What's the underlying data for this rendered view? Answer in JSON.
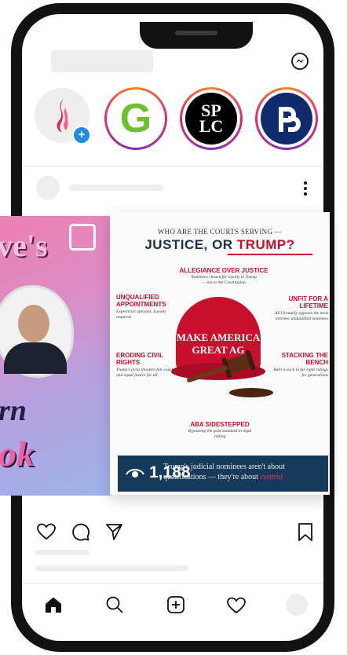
{
  "app": {
    "name": "Instagram"
  },
  "header": {
    "messenger_icon": "messenger-icon"
  },
  "stories": [
    {
      "name": "your-story",
      "icon": "flame-logo"
    },
    {
      "name": "g-logo",
      "text": "G"
    },
    {
      "name": "splc-logo",
      "text": "SP LC"
    },
    {
      "name": "pp-logo",
      "text": "P"
    }
  ],
  "post_left": {
    "text_top": "ve's",
    "text_mid": "rn",
    "text_bot": "ok"
  },
  "post_right": {
    "eyebrow": "WHO ARE THE COURTS SERVING —",
    "title_a": "JUSTICE, OR ",
    "title_b": "TRUMP?",
    "allegiance_title": "ALLEGIANCE OVER JUSTICE",
    "allegiance_sub": "Nominees chosen for loyalty to Trump — not to the Constitution",
    "unqualified_title": "UNQUALIFIED APPOINTMENTS",
    "unqualified_sub": "Experience optional. Loyalty required.",
    "unfit_title": "UNFIT FOR A LIFETIME",
    "unfit_sub": "AEJ formally opposes the most extreme, unqualified nominees",
    "eroding_title": "ERODING CIVIL RIGHTS",
    "eroding_sub": "Trump's picks threaten fair courts and equal justice for all.",
    "stacking_title": "STACKING THE BENCH",
    "stacking_sub": "Built to lock in far-right rulings for generations",
    "aba_title": "ABA SIDESTEPPED",
    "aba_sub": "Bypassing the gold standard in legal vetting",
    "hat_line1": "MAKE AMERICA",
    "hat_line2": "GREAT AG",
    "count": "1,188",
    "footer_text_a": "Trump's judicial nominees aren't about",
    "footer_text_b": "qualifications — they're about ",
    "footer_text_c": "control"
  },
  "actions": {
    "like": "heart-icon",
    "comment": "comment-icon",
    "share": "send-icon",
    "save": "bookmark-icon"
  },
  "nav": [
    "home-icon",
    "search-icon",
    "new-post-icon",
    "activity-icon",
    "profile-avatar"
  ],
  "colors": {
    "accent_red": "#c8102e",
    "navy": "#183a5a",
    "story_ring": "#dd2a7b",
    "badge_blue": "#1d8fe1"
  }
}
